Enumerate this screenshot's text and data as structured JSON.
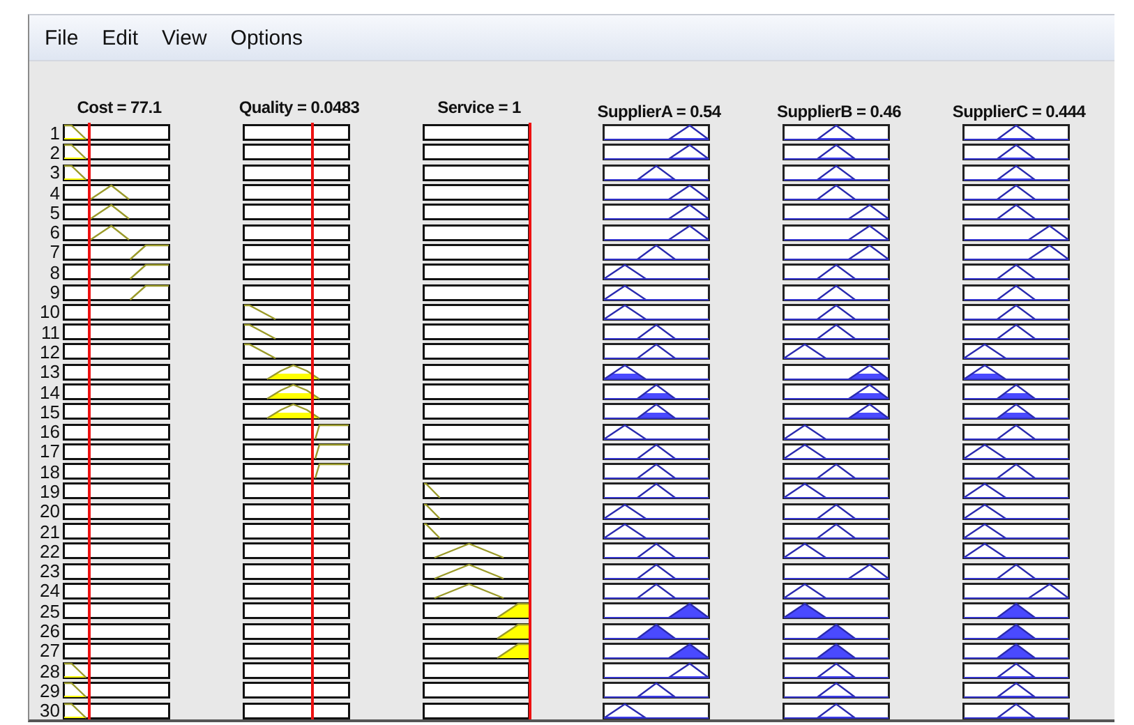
{
  "menu": [
    "File",
    "Edit",
    "View",
    "Options"
  ],
  "inputs": [
    {
      "label": "Cost = 77.1"
    },
    {
      "label": "Quality = 0.0483"
    },
    {
      "label": "Service = 1"
    }
  ],
  "outputs": [
    {
      "label": "SupplierA = 0.54"
    },
    {
      "label": "SupplierB = 0.46"
    },
    {
      "label": "SupplierC = 0.444"
    }
  ],
  "rules": [
    {
      "number": "1",
      "inputs": [
        {
          "kind": "low-tip"
        },
        {
          "kind": "empty"
        },
        {
          "kind": "empty"
        }
      ],
      "outputs": [
        {
          "kind": "high-tip"
        },
        {
          "kind": "mid-tip"
        },
        {
          "kind": "mid-tip"
        }
      ]
    },
    {
      "number": "2",
      "inputs": [
        {
          "kind": "low-tip"
        },
        {
          "kind": "empty"
        },
        {
          "kind": "empty"
        }
      ],
      "outputs": [
        {
          "kind": "high-tip"
        },
        {
          "kind": "mid-tip"
        },
        {
          "kind": "mid-tip"
        }
      ]
    },
    {
      "number": "3",
      "inputs": [
        {
          "kind": "low-tip"
        },
        {
          "kind": "empty"
        },
        {
          "kind": "empty"
        }
      ],
      "outputs": [
        {
          "kind": "mid-tip"
        },
        {
          "kind": "mid-tip"
        },
        {
          "kind": "mid-tip"
        }
      ]
    },
    {
      "number": "4",
      "inputs": [
        {
          "kind": "mid"
        },
        {
          "kind": "empty"
        },
        {
          "kind": "empty"
        }
      ],
      "outputs": [
        {
          "kind": "high"
        },
        {
          "kind": "mid"
        },
        {
          "kind": "mid"
        }
      ]
    },
    {
      "number": "5",
      "inputs": [
        {
          "kind": "mid"
        },
        {
          "kind": "empty"
        },
        {
          "kind": "empty"
        }
      ],
      "outputs": [
        {
          "kind": "high"
        },
        {
          "kind": "high"
        },
        {
          "kind": "mid"
        }
      ]
    },
    {
      "number": "6",
      "inputs": [
        {
          "kind": "mid"
        },
        {
          "kind": "empty"
        },
        {
          "kind": "empty"
        }
      ],
      "outputs": [
        {
          "kind": "high"
        },
        {
          "kind": "high"
        },
        {
          "kind": "high"
        }
      ]
    },
    {
      "number": "7",
      "inputs": [
        {
          "kind": "high"
        },
        {
          "kind": "empty"
        },
        {
          "kind": "empty"
        }
      ],
      "outputs": [
        {
          "kind": "mid"
        },
        {
          "kind": "high"
        },
        {
          "kind": "high"
        }
      ]
    },
    {
      "number": "8",
      "inputs": [
        {
          "kind": "high"
        },
        {
          "kind": "empty"
        },
        {
          "kind": "empty"
        }
      ],
      "outputs": [
        {
          "kind": "low"
        },
        {
          "kind": "mid"
        },
        {
          "kind": "mid"
        }
      ]
    },
    {
      "number": "9",
      "inputs": [
        {
          "kind": "high"
        },
        {
          "kind": "empty"
        },
        {
          "kind": "empty"
        }
      ],
      "outputs": [
        {
          "kind": "low"
        },
        {
          "kind": "mid"
        },
        {
          "kind": "mid"
        }
      ]
    },
    {
      "number": "10",
      "inputs": [
        {
          "kind": "empty"
        },
        {
          "kind": "low"
        },
        {
          "kind": "empty"
        }
      ],
      "outputs": [
        {
          "kind": "low"
        },
        {
          "kind": "mid"
        },
        {
          "kind": "mid"
        }
      ]
    },
    {
      "number": "11",
      "inputs": [
        {
          "kind": "empty"
        },
        {
          "kind": "low"
        },
        {
          "kind": "empty"
        }
      ],
      "outputs": [
        {
          "kind": "mid"
        },
        {
          "kind": "mid"
        },
        {
          "kind": "mid"
        }
      ]
    },
    {
      "number": "12",
      "inputs": [
        {
          "kind": "empty"
        },
        {
          "kind": "low"
        },
        {
          "kind": "empty"
        }
      ],
      "outputs": [
        {
          "kind": "mid"
        },
        {
          "kind": "low"
        },
        {
          "kind": "low"
        }
      ]
    },
    {
      "number": "13",
      "inputs": [
        {
          "kind": "empty"
        },
        {
          "kind": "mid-half"
        },
        {
          "kind": "empty"
        }
      ],
      "outputs": [
        {
          "kind": "low-half"
        },
        {
          "kind": "high-half"
        },
        {
          "kind": "low-half"
        }
      ]
    },
    {
      "number": "14",
      "inputs": [
        {
          "kind": "empty"
        },
        {
          "kind": "mid-half"
        },
        {
          "kind": "empty"
        }
      ],
      "outputs": [
        {
          "kind": "mid-half"
        },
        {
          "kind": "high-half"
        },
        {
          "kind": "mid-half"
        }
      ]
    },
    {
      "number": "15",
      "inputs": [
        {
          "kind": "empty"
        },
        {
          "kind": "mid-half"
        },
        {
          "kind": "empty"
        }
      ],
      "outputs": [
        {
          "kind": "mid-half"
        },
        {
          "kind": "high-half"
        },
        {
          "kind": "mid-half"
        }
      ]
    },
    {
      "number": "16",
      "inputs": [
        {
          "kind": "empty"
        },
        {
          "kind": "high"
        },
        {
          "kind": "empty"
        }
      ],
      "outputs": [
        {
          "kind": "low"
        },
        {
          "kind": "low"
        },
        {
          "kind": "mid"
        }
      ]
    },
    {
      "number": "17",
      "inputs": [
        {
          "kind": "empty"
        },
        {
          "kind": "high"
        },
        {
          "kind": "empty"
        }
      ],
      "outputs": [
        {
          "kind": "mid"
        },
        {
          "kind": "low"
        },
        {
          "kind": "low"
        }
      ]
    },
    {
      "number": "18",
      "inputs": [
        {
          "kind": "empty"
        },
        {
          "kind": "high"
        },
        {
          "kind": "empty"
        }
      ],
      "outputs": [
        {
          "kind": "mid"
        },
        {
          "kind": "mid"
        },
        {
          "kind": "mid"
        }
      ]
    },
    {
      "number": "19",
      "inputs": [
        {
          "kind": "empty"
        },
        {
          "kind": "empty"
        },
        {
          "kind": "low"
        }
      ],
      "outputs": [
        {
          "kind": "mid"
        },
        {
          "kind": "low"
        },
        {
          "kind": "low"
        }
      ]
    },
    {
      "number": "20",
      "inputs": [
        {
          "kind": "empty"
        },
        {
          "kind": "empty"
        },
        {
          "kind": "low"
        }
      ],
      "outputs": [
        {
          "kind": "low"
        },
        {
          "kind": "mid"
        },
        {
          "kind": "low"
        }
      ]
    },
    {
      "number": "21",
      "inputs": [
        {
          "kind": "empty"
        },
        {
          "kind": "empty"
        },
        {
          "kind": "low"
        }
      ],
      "outputs": [
        {
          "kind": "low"
        },
        {
          "kind": "mid"
        },
        {
          "kind": "low"
        }
      ]
    },
    {
      "number": "22",
      "inputs": [
        {
          "kind": "empty"
        },
        {
          "kind": "empty"
        },
        {
          "kind": "mid"
        }
      ],
      "outputs": [
        {
          "kind": "mid"
        },
        {
          "kind": "low"
        },
        {
          "kind": "low"
        }
      ]
    },
    {
      "number": "23",
      "inputs": [
        {
          "kind": "empty"
        },
        {
          "kind": "empty"
        },
        {
          "kind": "mid"
        }
      ],
      "outputs": [
        {
          "kind": "mid"
        },
        {
          "kind": "high"
        },
        {
          "kind": "mid"
        }
      ]
    },
    {
      "number": "24",
      "inputs": [
        {
          "kind": "empty"
        },
        {
          "kind": "empty"
        },
        {
          "kind": "mid"
        }
      ],
      "outputs": [
        {
          "kind": "mid"
        },
        {
          "kind": "low"
        },
        {
          "kind": "high"
        }
      ]
    },
    {
      "number": "25",
      "inputs": [
        {
          "kind": "empty"
        },
        {
          "kind": "empty"
        },
        {
          "kind": "high-full"
        }
      ],
      "outputs": [
        {
          "kind": "high-full"
        },
        {
          "kind": "low-full"
        },
        {
          "kind": "mid-full"
        }
      ]
    },
    {
      "number": "26",
      "inputs": [
        {
          "kind": "empty"
        },
        {
          "kind": "empty"
        },
        {
          "kind": "high-full"
        }
      ],
      "outputs": [
        {
          "kind": "mid-full"
        },
        {
          "kind": "mid-full"
        },
        {
          "kind": "mid-full"
        }
      ]
    },
    {
      "number": "27",
      "inputs": [
        {
          "kind": "empty"
        },
        {
          "kind": "empty"
        },
        {
          "kind": "high-full"
        }
      ],
      "outputs": [
        {
          "kind": "high-full"
        },
        {
          "kind": "mid-full"
        },
        {
          "kind": "mid-full"
        }
      ]
    },
    {
      "number": "28",
      "inputs": [
        {
          "kind": "low-tip"
        },
        {
          "kind": "empty"
        },
        {
          "kind": "empty"
        }
      ],
      "outputs": [
        {
          "kind": "high-tip"
        },
        {
          "kind": "mid-tip"
        },
        {
          "kind": "mid-tip"
        }
      ]
    },
    {
      "number": "29",
      "inputs": [
        {
          "kind": "low-tip"
        },
        {
          "kind": "empty"
        },
        {
          "kind": "empty"
        }
      ],
      "outputs": [
        {
          "kind": "mid-tip"
        },
        {
          "kind": "mid-tip"
        },
        {
          "kind": "mid-tip"
        }
      ]
    },
    {
      "number": "30",
      "inputs": [
        {
          "kind": "low-tip"
        },
        {
          "kind": "empty"
        },
        {
          "kind": "empty"
        }
      ],
      "outputs": [
        {
          "kind": "low-tip"
        },
        {
          "kind": "mid-tip"
        },
        {
          "kind": "mid-tip"
        }
      ]
    }
  ]
}
